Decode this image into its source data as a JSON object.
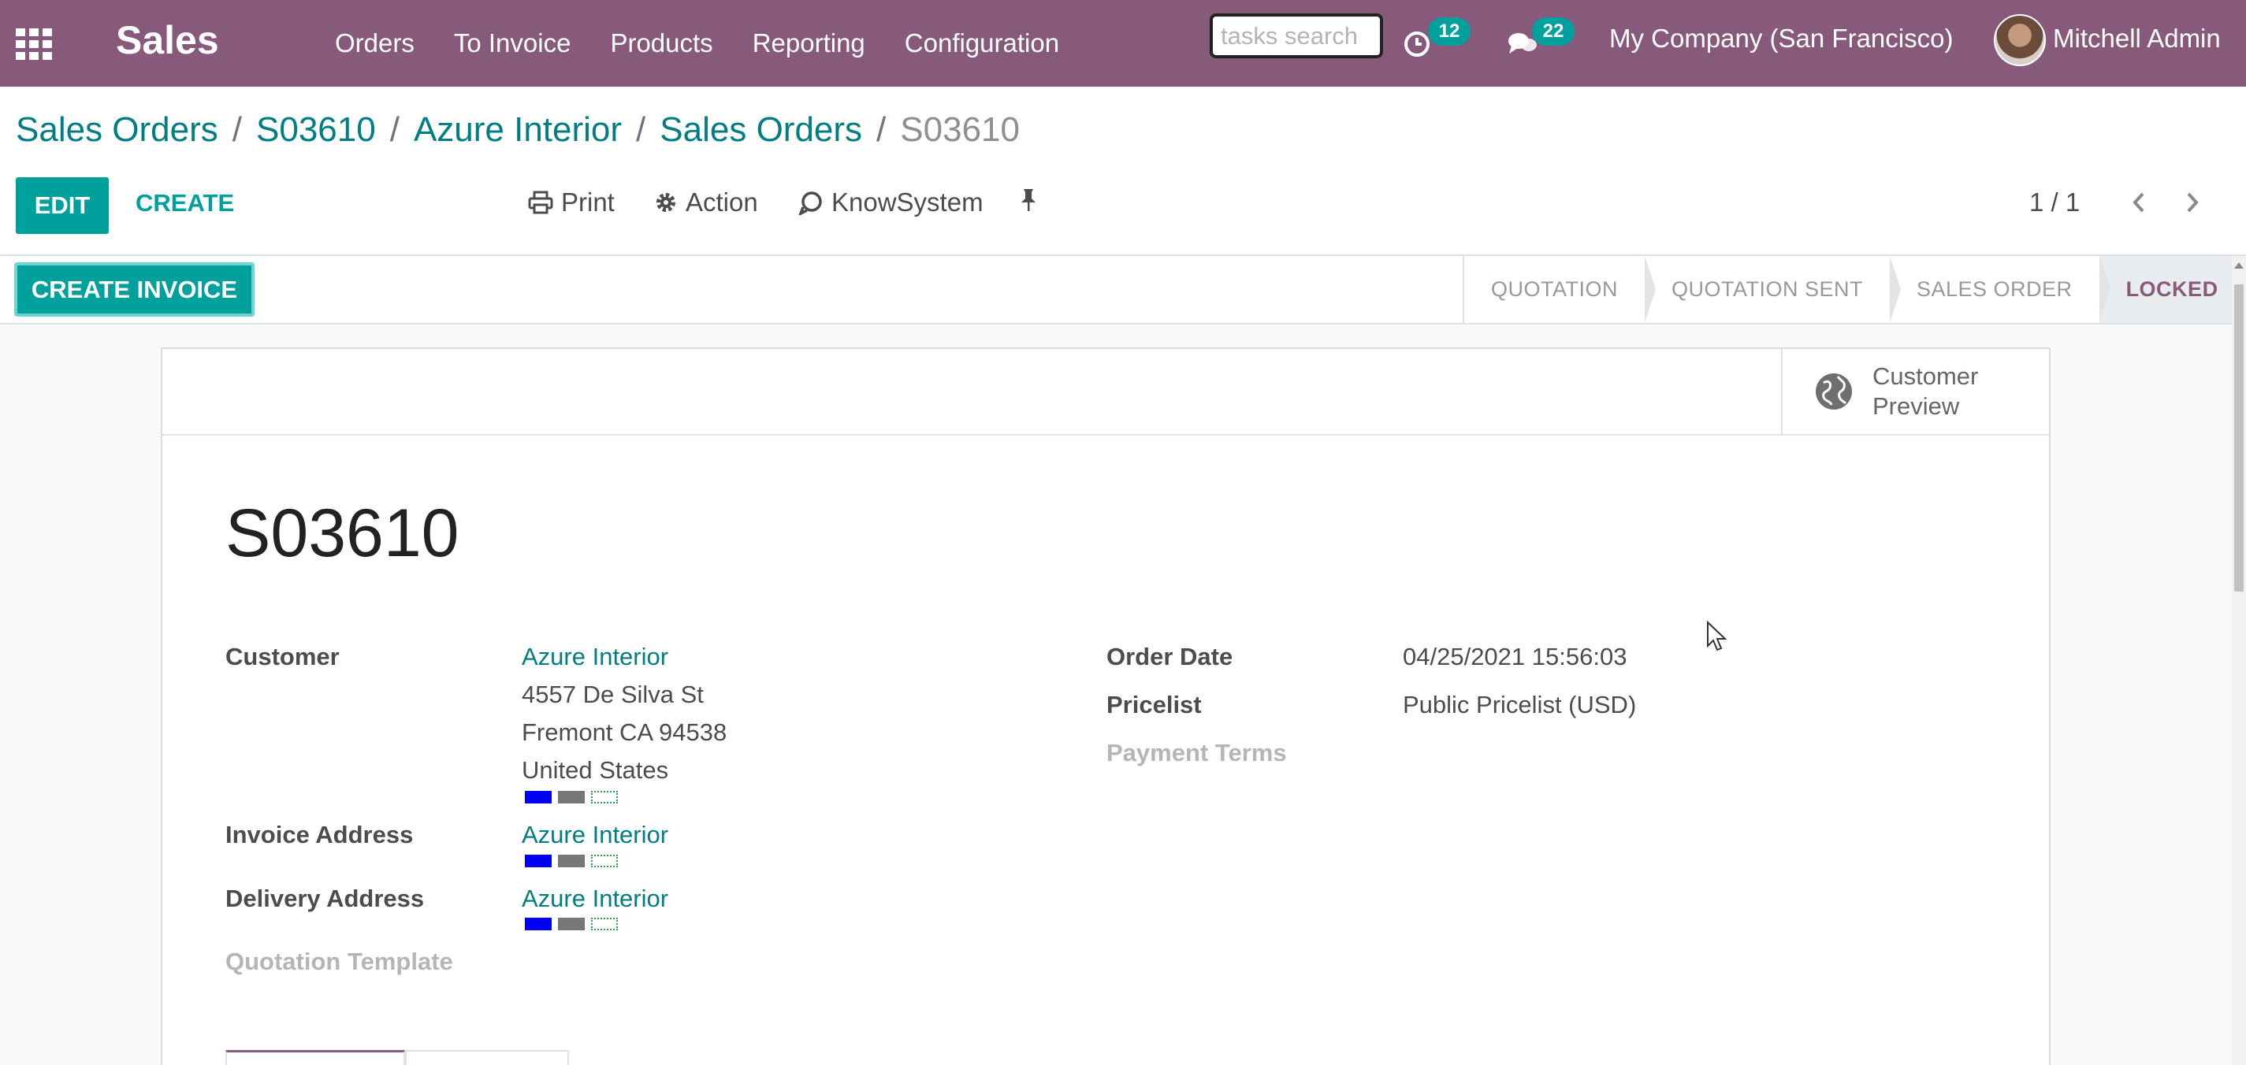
{
  "navbar": {
    "app_title": "Sales",
    "menu": [
      "Orders",
      "To Invoice",
      "Products",
      "Reporting",
      "Configuration"
    ],
    "search_placeholder": "tasks search",
    "activity_count": "12",
    "messages_count": "22",
    "company": "My Company (San Francisco)",
    "user": "Mitchell Admin",
    "brand_color": "#875a7b",
    "accent_color": "#00a09d"
  },
  "breadcrumb": {
    "items": [
      "Sales Orders",
      "S03610",
      "Azure Interior",
      "Sales Orders"
    ],
    "current": "S03610"
  },
  "toolbar": {
    "edit_label": "EDIT",
    "create_label": "CREATE",
    "print_label": "Print",
    "action_label": "Action",
    "knowsystem_label": "KnowSystem",
    "pager": "1 / 1"
  },
  "statusbar": {
    "create_invoice_label": "CREATE INVOICE",
    "stages": [
      "QUOTATION",
      "QUOTATION SENT",
      "SALES ORDER",
      "LOCKED"
    ],
    "active_stage": "LOCKED"
  },
  "form": {
    "customer_preview_line1": "Customer",
    "customer_preview_line2": "Preview",
    "order_name": "S03610",
    "customer_label": "Customer",
    "customer_name": "Azure Interior",
    "customer_address": [
      "4557 De Silva St",
      "Fremont CA 94538",
      "United States"
    ],
    "invoice_address_label": "Invoice Address",
    "invoice_address": "Azure Interior",
    "delivery_address_label": "Delivery Address",
    "delivery_address": "Azure Interior",
    "quotation_template_label": "Quotation Template",
    "order_date_label": "Order Date",
    "order_date": "04/25/2021 15:56:03",
    "pricelist_label": "Pricelist",
    "pricelist": "Public Pricelist (USD)",
    "payment_terms_label": "Payment Terms"
  }
}
